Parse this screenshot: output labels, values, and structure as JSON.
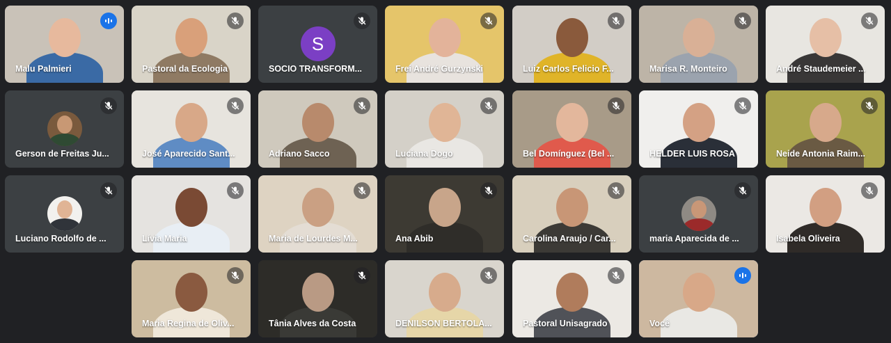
{
  "participants": [
    {
      "name": "Malu Palmieri",
      "mic": "active",
      "bg": "#c9c2b8",
      "skin": "#e7b99d",
      "shirt": "#3a6aa5"
    },
    {
      "name": "Pastoral da Ecologia",
      "mic": "muted",
      "bg": "#d9d4c8",
      "skin": "#d9a07a",
      "shirt": "#8f7a63"
    },
    {
      "name": "SOCIO TRANSFORM...",
      "mic": "muted",
      "avatar": "S"
    },
    {
      "name": "Frei André Gurzynski",
      "mic": "muted",
      "bg": "#e5c56a",
      "skin": "#e3b39a",
      "shirt": "#e8e3de"
    },
    {
      "name": "Luiz Carlos Felicio F...",
      "mic": "muted",
      "bg": "#d2cdc6",
      "skin": "#8a5a3c",
      "shirt": "#e0b428"
    },
    {
      "name": "Marisa R. Monteiro",
      "mic": "muted",
      "bg": "#bdb4a7",
      "skin": "#d9b096",
      "shirt": "#9ba3ae"
    },
    {
      "name": "André Staudemeier ...",
      "mic": "muted",
      "bg": "#e8e6e1",
      "skin": "#e6bfa6",
      "shirt": "#393737"
    },
    {
      "name": "Gerson de Freitas Ju...",
      "mic": "muted",
      "small": true,
      "bg": "#7a5a3d",
      "skin": "#c89874",
      "shirt": "#2f4a33"
    },
    {
      "name": "José Aparecido Sant...",
      "mic": "muted",
      "bg": "#e7e4de",
      "skin": "#d8a888",
      "shirt": "#5f8cc4"
    },
    {
      "name": "Adriano Sacco",
      "mic": "muted",
      "bg": "#cfc9bd",
      "skin": "#b88a6c",
      "shirt": "#6e6253"
    },
    {
      "name": "Luciana Dogo",
      "mic": "muted",
      "bg": "#d4d0c8",
      "skin": "#e0b596",
      "shirt": "#e9e7e3"
    },
    {
      "name": "Bel Domínguez (Bel ...",
      "mic": "muted",
      "bg": "#a89b88",
      "skin": "#e3b79c",
      "shirt": "#e05a4c"
    },
    {
      "name": "HELDER LUIS ROSA",
      "mic": "muted",
      "bg": "#f0efed",
      "skin": "#d4a184",
      "shirt": "#2a2f38"
    },
    {
      "name": "Neide Antonia Raim...",
      "mic": "muted",
      "bg": "#a9a34d",
      "skin": "#d7a98b",
      "shirt": "#6a5a43"
    },
    {
      "name": "Luciano Rodolfo de ...",
      "mic": "muted",
      "small": true,
      "bg": "#f2f1ee",
      "skin": "#e0b495",
      "shirt": "#30343a"
    },
    {
      "name": "Lívia Maria",
      "mic": "muted",
      "bg": "#e5e3e0",
      "skin": "#7a4a34",
      "shirt": "#e8eef4"
    },
    {
      "name": "Maria de Lourdes M...",
      "mic": "muted",
      "bg": "#ded3c2",
      "skin": "#caa083",
      "shirt": "#e4ddd4"
    },
    {
      "name": "Ana Abib",
      "mic": "muted",
      "bg": "#3d3a33",
      "skin": "#c8a58a",
      "shirt": "#2f2d29"
    },
    {
      "name": "Carolina Araujo / Car...",
      "mic": "muted",
      "bg": "#d8cfbd",
      "skin": "#c89676",
      "shirt": "#3c3a36"
    },
    {
      "name": "maria Aparecida de ...",
      "mic": "muted",
      "small": true,
      "bg": "#8f8a84",
      "skin": "#c99777",
      "shirt": "#9b2a2a"
    },
    {
      "name": "Isabela Oliveira",
      "mic": "muted",
      "bg": "#ebe8e4",
      "skin": "#d29f82",
      "shirt": "#2f2b28"
    },
    {
      "name": "Maria Regina de Oliv...",
      "mic": "muted",
      "bg": "#cdbca0",
      "skin": "#8a5a40",
      "shirt": "#efe7d9"
    },
    {
      "name": "Tânia Alves da Costa",
      "mic": "muted",
      "bg": "#2d2c28",
      "skin": "#b99a84",
      "shirt": "#3a3a36"
    },
    {
      "name": "DENILSON BERTOLA...",
      "mic": "muted",
      "bg": "#d9d5cd",
      "skin": "#d7ab8c",
      "shirt": "#e6d6a8"
    },
    {
      "name": "Pastoral Unisagrado",
      "mic": "muted",
      "bg": "#ece9e4",
      "skin": "#b07c5c",
      "shirt": "#505258"
    },
    {
      "name": "Você",
      "mic": "active",
      "self": true,
      "bg": "#cdb8a0",
      "skin": "#d8a888",
      "shirt": "#e9e8e4"
    }
  ]
}
